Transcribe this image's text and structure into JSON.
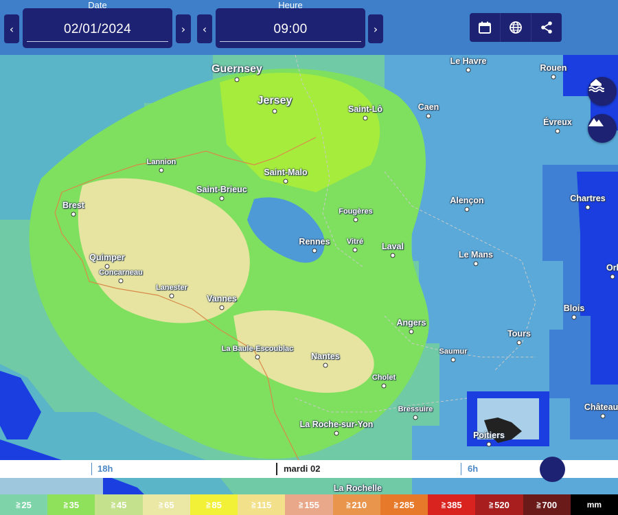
{
  "header": {
    "date_label": "Date",
    "date_value": "02/01/2024",
    "time_label": "Heure",
    "time_value": "09:00",
    "prev_icon": "chevron-left-icon",
    "next_icon": "chevron-right-icon",
    "tools": [
      "calendar-icon",
      "globe-icon",
      "share-icon"
    ]
  },
  "map": {
    "places": [
      {
        "name": "Guernsey",
        "size": "big"
      },
      {
        "name": "Jersey",
        "size": "big"
      },
      {
        "name": "Le Havre",
        "size": ""
      },
      {
        "name": "Rouen",
        "size": ""
      },
      {
        "name": "Caen",
        "size": ""
      },
      {
        "name": "Saint-Lô",
        "size": ""
      },
      {
        "name": "Évreux",
        "size": ""
      },
      {
        "name": "Lannion",
        "size": "small"
      },
      {
        "name": "Saint-Malo",
        "size": ""
      },
      {
        "name": "Saint-Brieuc",
        "size": ""
      },
      {
        "name": "Brest",
        "size": ""
      },
      {
        "name": "Fougères",
        "size": "small"
      },
      {
        "name": "Alençon",
        "size": ""
      },
      {
        "name": "Chartres",
        "size": ""
      },
      {
        "name": "Rennes",
        "size": ""
      },
      {
        "name": "Vitré",
        "size": "small"
      },
      {
        "name": "Laval",
        "size": ""
      },
      {
        "name": "Quimper",
        "size": ""
      },
      {
        "name": "Concarneau",
        "size": "small"
      },
      {
        "name": "Le Mans",
        "size": ""
      },
      {
        "name": "Orl",
        "size": ""
      },
      {
        "name": "Lanester",
        "size": "small"
      },
      {
        "name": "Vannes",
        "size": ""
      },
      {
        "name": "Blois",
        "size": ""
      },
      {
        "name": "Angers",
        "size": ""
      },
      {
        "name": "Tours",
        "size": ""
      },
      {
        "name": "La Baule-Escoublac",
        "size": "small"
      },
      {
        "name": "Nantes",
        "size": ""
      },
      {
        "name": "Saumur",
        "size": "small"
      },
      {
        "name": "Cholet",
        "size": "small"
      },
      {
        "name": "Bressuire",
        "size": "small"
      },
      {
        "name": "Châteaur",
        "size": ""
      },
      {
        "name": "La Roche-sur-Yon",
        "size": ""
      },
      {
        "name": "Poitiers",
        "size": ""
      },
      {
        "name": "La Rochelle",
        "size": ""
      }
    ],
    "buttons": [
      "flood-icon",
      "mountain-icon"
    ]
  },
  "timeline": {
    "labels": [
      "18h",
      "mardi 02",
      "6h"
    ]
  },
  "legend": {
    "items": [
      {
        "label": "25",
        "color": "#7ed3a9"
      },
      {
        "label": "35",
        "color": "#8fe05a"
      },
      {
        "label": "45",
        "color": "#c4e28d"
      },
      {
        "label": "65",
        "color": "#ebe7a5"
      },
      {
        "label": "85",
        "color": "#f3f038"
      },
      {
        "label": "115",
        "color": "#f2e08a"
      },
      {
        "label": "155",
        "color": "#e9a88a"
      },
      {
        "label": "210",
        "color": "#e9954c"
      },
      {
        "label": "285",
        "color": "#e7792a"
      },
      {
        "label": "385",
        "color": "#d9231e"
      },
      {
        "label": "520",
        "color": "#a81d1d"
      },
      {
        "label": "700",
        "color": "#6b1a1a"
      }
    ],
    "ge_symbol": "≥",
    "unit": "mm"
  }
}
